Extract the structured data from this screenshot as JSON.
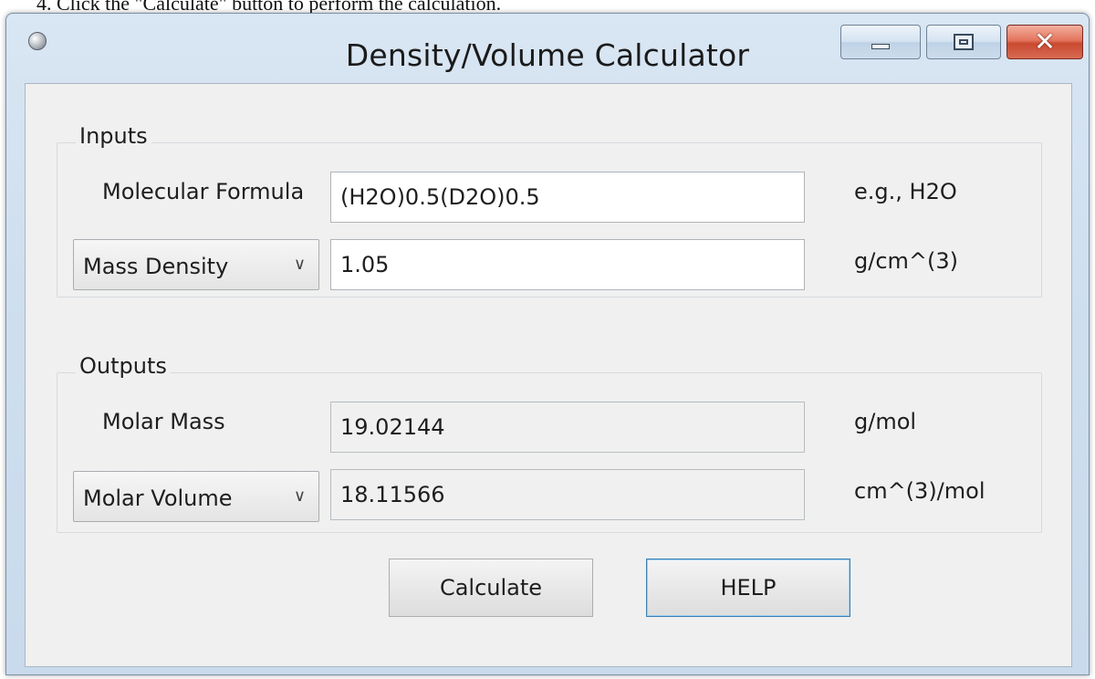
{
  "instruction": "4.  Click the \"Calculate\" button to perform the calculation.",
  "window": {
    "title": "Density/Volume Calculator",
    "icon": "app-orb-icon",
    "caption_buttons": [
      "minimize",
      "maximize",
      "close"
    ],
    "close_glyph": "✕"
  },
  "inputs": {
    "group_label": "Inputs",
    "formula_label": "Molecular Formula",
    "formula_value": "(H2O)0.5(D2O)0.5",
    "formula_hint": "e.g., H2O",
    "density_select": "Mass Density",
    "density_value": "1.05",
    "density_unit": "g/cm^(3)"
  },
  "outputs": {
    "group_label": "Outputs",
    "molar_mass_label": "Molar Mass",
    "molar_mass_value": "19.02144",
    "molar_mass_unit": "g/mol",
    "volume_select": "Molar Volume",
    "volume_value": "18.11566",
    "volume_unit": "cm^(3)/mol"
  },
  "buttons": {
    "calculate": "Calculate",
    "help": "HELP"
  },
  "colors": {
    "window_frame": "#cfdfef",
    "client_bg": "#f0f0f0",
    "close_button": "#d86a52",
    "focus_border": "#3c7fb1"
  }
}
